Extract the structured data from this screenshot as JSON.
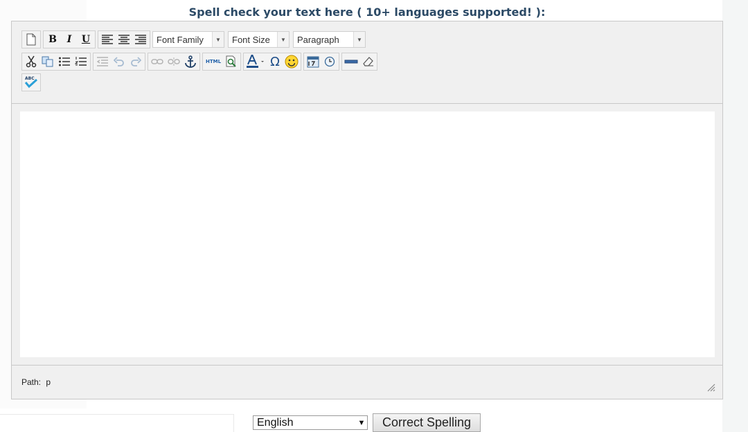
{
  "heading": "Spell check your text here ( 10+ languages supported! ):",
  "toolbar": {
    "row1": {
      "font_family": "Font Family",
      "font_size": "Font Size",
      "format": "Paragraph",
      "bold": "B",
      "italic": "I",
      "underline": "U"
    },
    "row2": {
      "html_label": "HTML",
      "special_char": "Ω",
      "spellcheck_label": "ABC"
    }
  },
  "editor": {
    "content": ""
  },
  "status": {
    "path_label": "Path:",
    "path_value": "p"
  },
  "controls": {
    "language": "English",
    "correct_button": "Correct Spelling"
  },
  "colors": {
    "heading": "#2c4a66",
    "toolbar_bg": "#f0f0f0",
    "accent_blue": "#1f5fa8"
  }
}
